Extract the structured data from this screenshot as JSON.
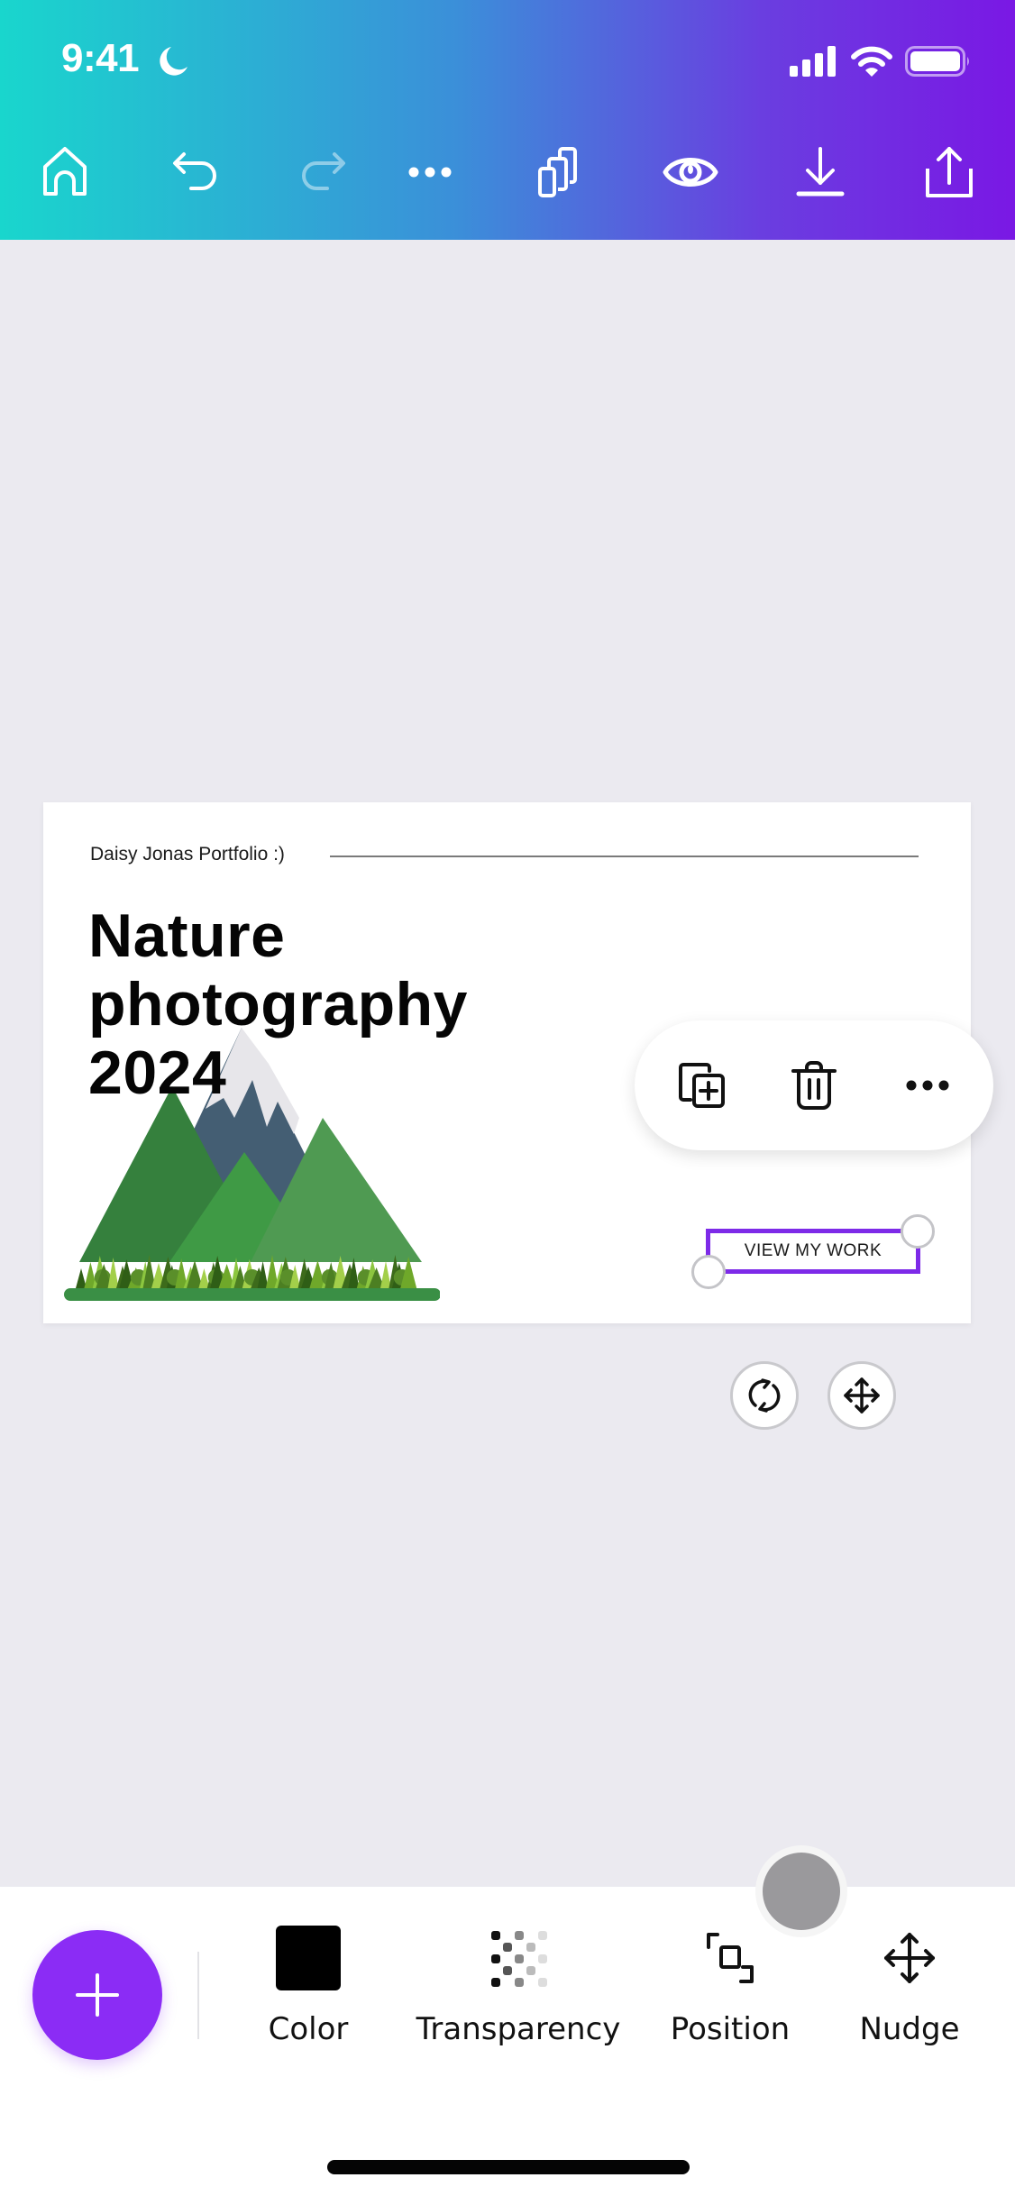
{
  "status_bar": {
    "time": "9:41",
    "focus_mode_icon": "moon-icon",
    "signal_icon": "cellular-signal-icon",
    "wifi_icon": "wifi-icon",
    "battery_icon": "battery-icon"
  },
  "toolbar": {
    "items": [
      {
        "name": "home",
        "icon": "home-icon",
        "enabled": true
      },
      {
        "name": "undo",
        "icon": "undo-icon",
        "enabled": true
      },
      {
        "name": "redo",
        "icon": "redo-icon",
        "enabled": false
      },
      {
        "name": "more",
        "icon": "more-horizontal-icon",
        "enabled": true
      },
      {
        "name": "pages",
        "icon": "pages-icon",
        "enabled": true
      },
      {
        "name": "preview",
        "icon": "eye-icon",
        "enabled": true
      },
      {
        "name": "download",
        "icon": "download-icon",
        "enabled": true
      },
      {
        "name": "share",
        "icon": "share-icon",
        "enabled": true
      }
    ]
  },
  "design": {
    "subtitle": "Daisy Jonas Portfolio :)",
    "title_lines": [
      "Nature",
      "photography",
      "2024"
    ],
    "cta_label": "VIEW MY WORK",
    "illustration": "mountains-forest-illustration",
    "selection_color": "#7d2ae8"
  },
  "context_menu": {
    "items": [
      {
        "name": "duplicate",
        "icon": "duplicate-icon"
      },
      {
        "name": "delete",
        "icon": "trash-icon"
      },
      {
        "name": "more",
        "icon": "more-horizontal-icon"
      }
    ]
  },
  "element_controls": {
    "rotate_icon": "rotate-icon",
    "move_icon": "move-icon"
  },
  "bottom_toolbar": {
    "add_button_icon": "plus-icon",
    "accent_color": "#8b2cf5",
    "tools": [
      {
        "label": "Color",
        "icon": "color-swatch-icon",
        "value": "#000000"
      },
      {
        "label": "Transparency",
        "icon": "transparency-icon"
      },
      {
        "label": "Position",
        "icon": "position-icon"
      },
      {
        "label": "Nudge",
        "icon": "nudge-icon"
      }
    ]
  },
  "colors": {
    "header_gradient_start": "#19d6cd",
    "header_gradient_end": "#7a18e4",
    "canvas_background": "#ebeaf0"
  }
}
